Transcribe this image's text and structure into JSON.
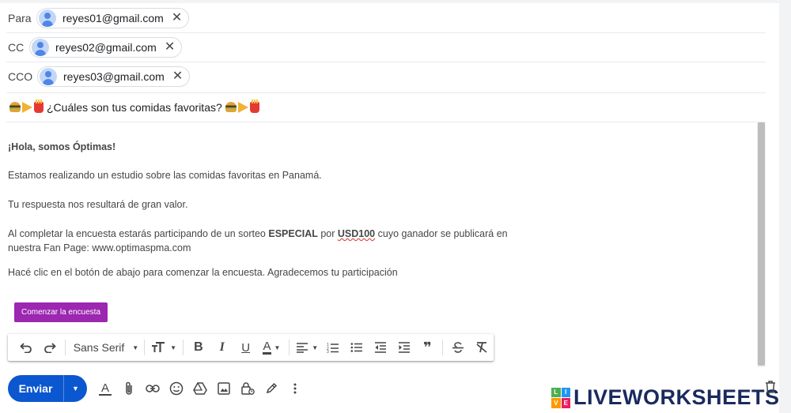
{
  "recipients": {
    "to": {
      "label": "Para",
      "email": "reyes01@gmail.com"
    },
    "cc": {
      "label": "CC",
      "email": "reyes02@gmail.com"
    },
    "bcc": {
      "label": "CCO",
      "email": "reyes03@gmail.com"
    },
    "remove_glyph": "✕"
  },
  "subject": {
    "text": "¿Cuáles son tus comidas favoritas?"
  },
  "body": {
    "greeting": "¡Hola, somos Óptimas!",
    "line1": "Estamos realizando un estudio sobre las comidas favoritas en Panamá.",
    "line2": "Tu respuesta nos resultará de gran valor.",
    "line3_part1": "Al completar la encuesta estarás participando de un sorteo ",
    "line3_especial": "ESPECIAL",
    "line3_part2": " por ",
    "line3_prize": "USD100",
    "line3_part3": " cuyo ganador se publicará en",
    "line3_part4": "nuestra Fan Page: www.optimaspma.com",
    "line4": "Hacé clic en el botón de abajo para comenzar la encuesta. Agradecemos tu participación",
    "cta_label": "Comenzar la encuesta"
  },
  "toolbar": {
    "font_name": "Sans Serif",
    "text_color_letter": "A",
    "quote_glyph": "❞"
  },
  "footer": {
    "send_label": "Enviar",
    "format_letter": "A"
  },
  "watermark": {
    "badge": [
      "L",
      "I",
      "V",
      "E"
    ],
    "text": "LIVEWORKSHEETS"
  },
  "colors": {
    "send_blue": "#0b57d0",
    "cta_purple": "#9c27b0",
    "logo_navy": "#1a2a5e"
  }
}
